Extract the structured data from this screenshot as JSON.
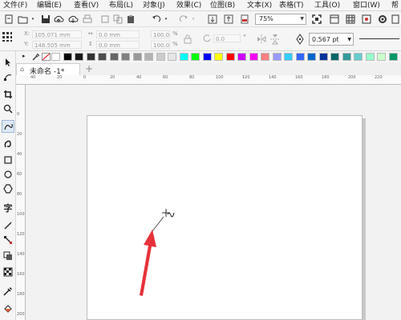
{
  "menu": [
    {
      "label": "文件(F)",
      "name": "menu-file"
    },
    {
      "label": "编辑(E)",
      "name": "menu-edit"
    },
    {
      "label": "查看(V)",
      "name": "menu-view"
    },
    {
      "label": "布局(L)",
      "name": "menu-layout"
    },
    {
      "label": "对象(J)",
      "name": "menu-object"
    },
    {
      "label": "效果(C)",
      "name": "menu-effects"
    },
    {
      "label": "位图(B)",
      "name": "menu-bitmaps"
    },
    {
      "label": "文本(X)",
      "name": "menu-text"
    },
    {
      "label": "表格(T)",
      "name": "menu-table"
    },
    {
      "label": "工具(O)",
      "name": "menu-tools"
    },
    {
      "label": "窗口(W)",
      "name": "menu-window"
    },
    {
      "label": "帮",
      "name": "menu-help"
    }
  ],
  "toolbar": {
    "zoom_value": "75%"
  },
  "property_bar": {
    "x_pos": "105.071 mm",
    "y_pos": "148.505 mm",
    "width": "0.0 mm",
    "height": "0.0 mm",
    "scale_x": "100.0",
    "scale_y": "100.0",
    "scale_unit": "%",
    "rotation": "0.0",
    "rotation_unit": "°",
    "outline_width": "0.567 pt"
  },
  "palette": [
    "#ffffff",
    "#000000",
    "#1a1a1a",
    "#333333",
    "#4d4d4d",
    "#666666",
    "#808080",
    "#999999",
    "#b3b3b3",
    "#cccccc",
    "#e6e6e6",
    "#00ffff",
    "#00ff00",
    "#0000ff",
    "#ffff00",
    "#ff0000",
    "#cc00ff",
    "#ff00ff",
    "#ff8080",
    "#9999ff",
    "#33ccff",
    "#3366ff",
    "#0066cc",
    "#003399",
    "#006666",
    "#339999",
    "#66cccc",
    "#99ffcc",
    "#ccffcc",
    "#009966"
  ],
  "document": {
    "tab_title": "未命名 -1*"
  },
  "ruler": {
    "h_labels": [
      "40",
      "20",
      "0",
      "20",
      "40",
      "60",
      "80",
      "100",
      "120",
      "140",
      "160",
      "180",
      "200",
      "220"
    ],
    "v_labels": [
      "0",
      "20",
      "40",
      "60",
      "80",
      "100",
      "120",
      "140",
      "160",
      "180",
      "200"
    ]
  },
  "annotation": {
    "arrow_color": "#e8313a"
  }
}
